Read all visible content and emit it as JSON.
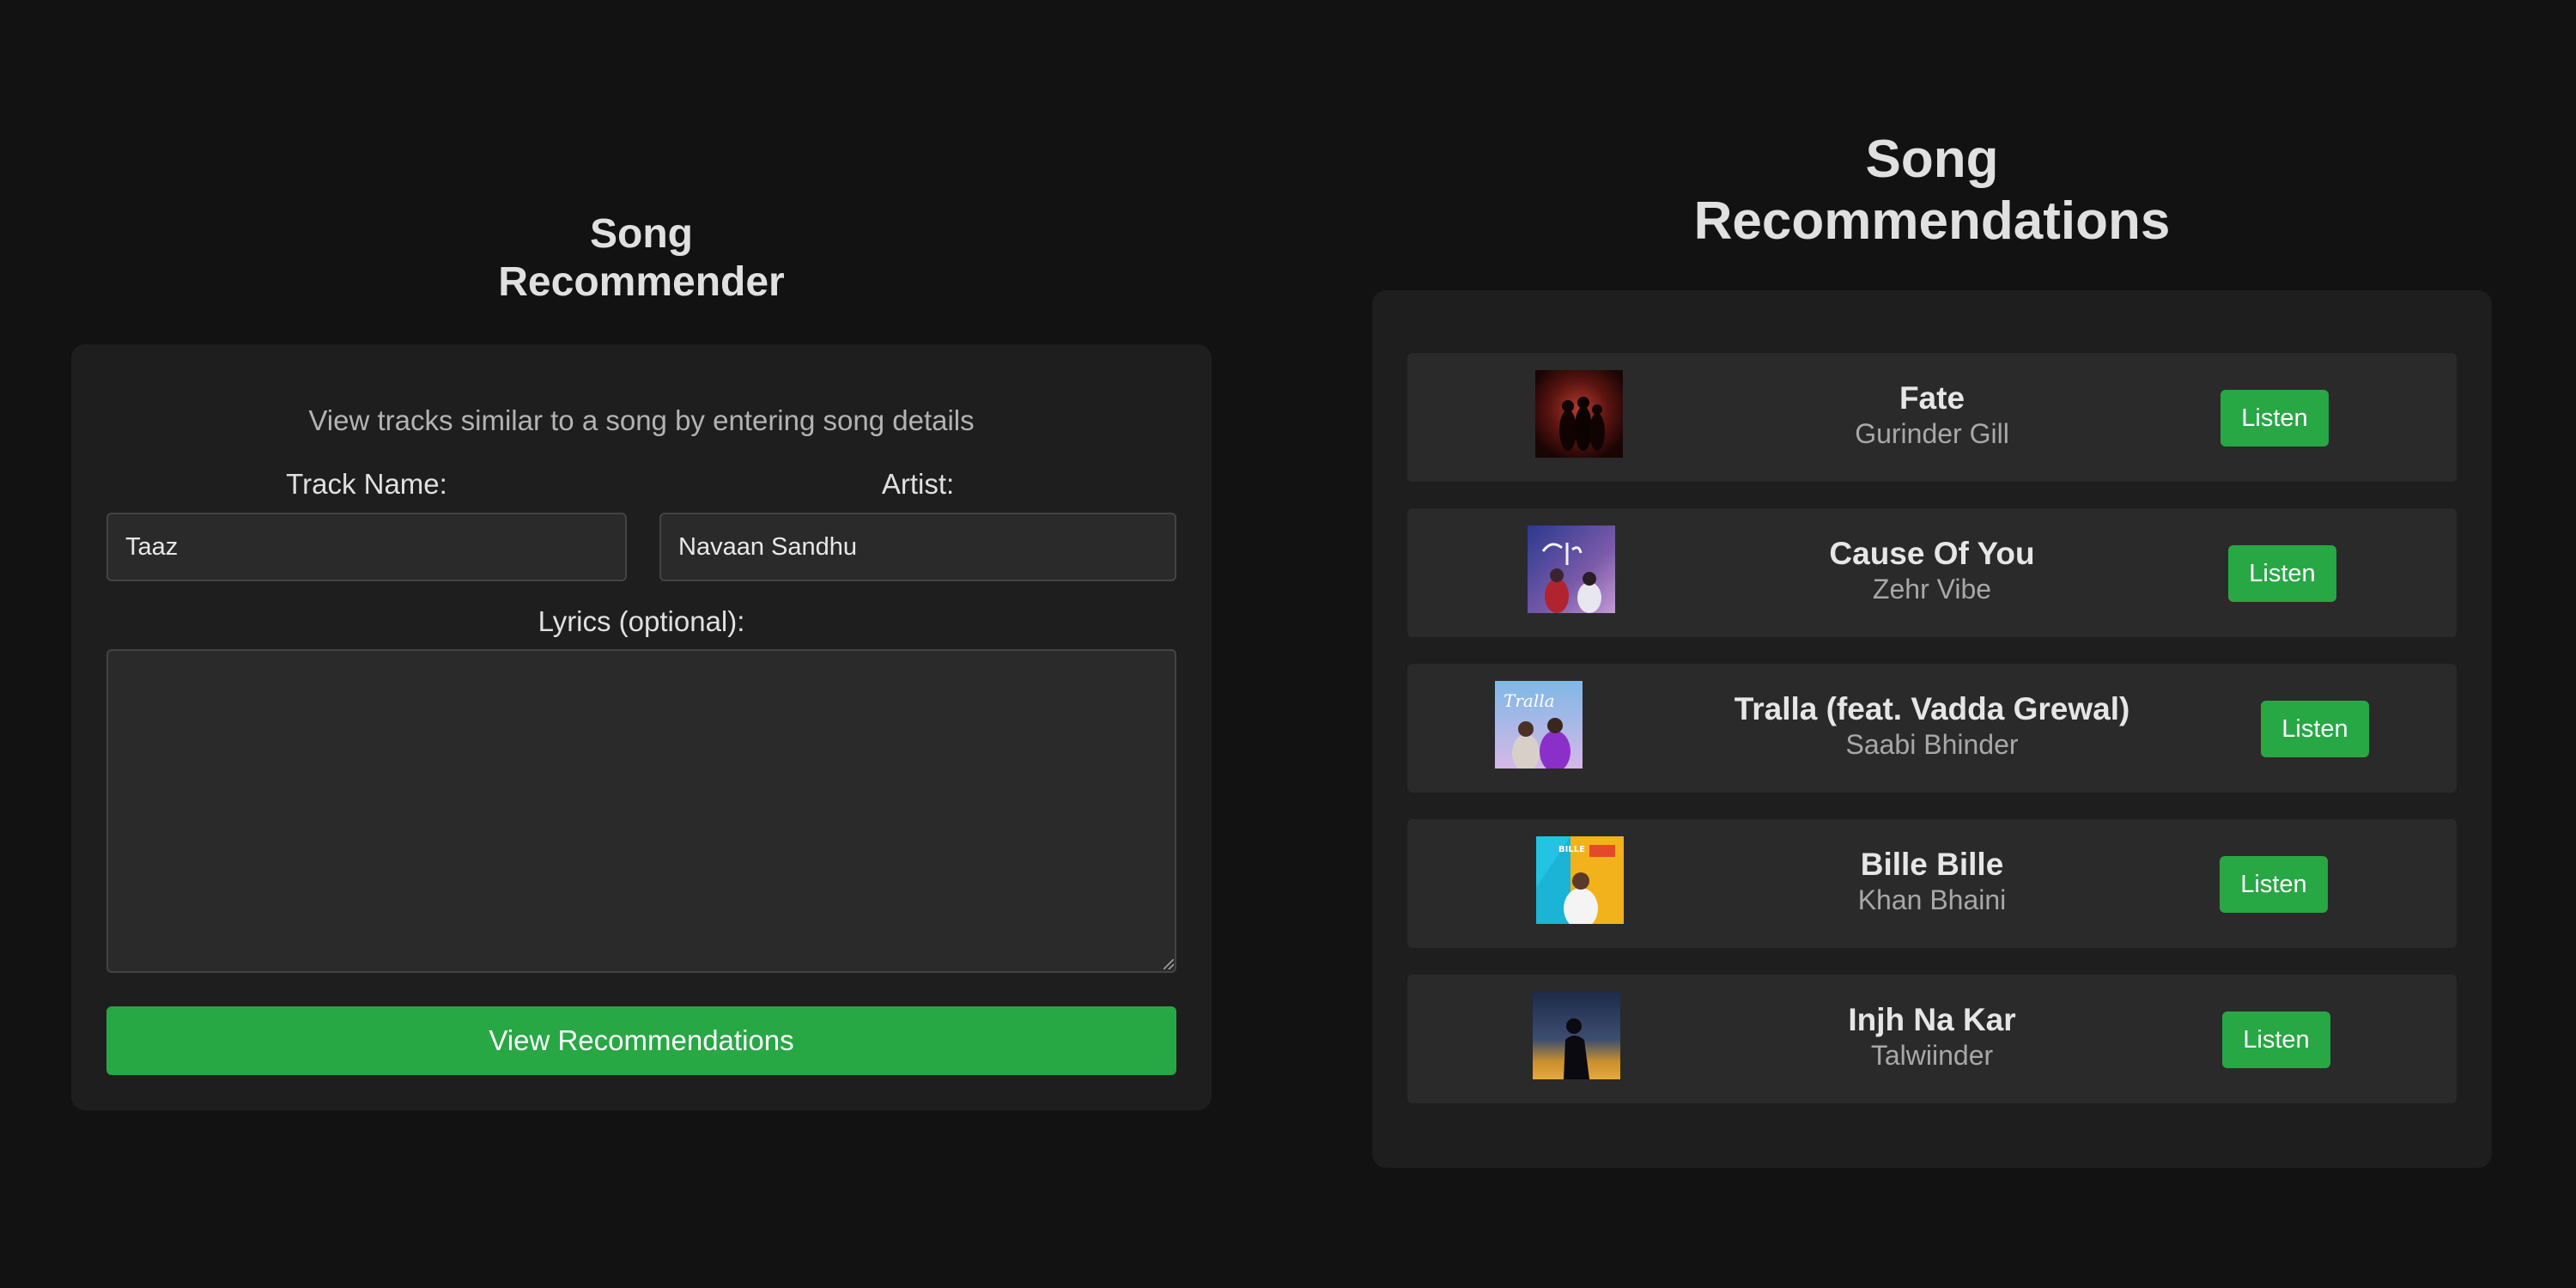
{
  "form": {
    "title_line1": "Song",
    "title_line2": "Recommender",
    "description": "View tracks similar to a song by entering song details",
    "track_label": "Track Name:",
    "track_value": "Taaz",
    "artist_label": "Artist:",
    "artist_value": "Navaan Sandhu",
    "lyrics_label": "Lyrics (optional):",
    "lyrics_value": "",
    "submit_label": "View Recommendations"
  },
  "recommendations": {
    "title_line1": "Song",
    "title_line2": "Recommendations",
    "items": [
      {
        "title": "Fate",
        "artist": "Gurinder Gill",
        "button": "Listen"
      },
      {
        "title": "Cause Of You",
        "artist": "Zehr Vibe",
        "button": "Listen"
      },
      {
        "title": "Tralla (feat. Vadda Grewal)",
        "artist": "Saabi Bhinder",
        "button": "Listen"
      },
      {
        "title": "Bille Bille",
        "artist": "Khan Bhaini",
        "button": "Listen"
      },
      {
        "title": "Injh Na Kar",
        "artist": "Talwiinder",
        "button": "Listen"
      }
    ]
  },
  "colors": {
    "background": "#121212",
    "card": "#1e1e1e",
    "item": "#2a2a2a",
    "accent": "#28a745"
  }
}
